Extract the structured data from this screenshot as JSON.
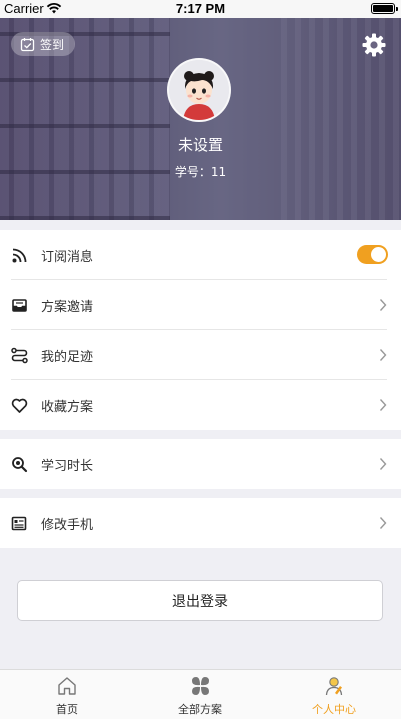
{
  "status_bar": {
    "carrier": "Carrier",
    "time": "7:17 PM",
    "wifi_icon": "wifi-icon",
    "battery_icon": "battery-icon"
  },
  "profile": {
    "checkin_label": "签到",
    "checkin_icon": "calendar-check-icon",
    "settings_icon": "gear-icon",
    "avatar_icon": "cartoon-girl-avatar",
    "nickname": "未设置",
    "student_id_label": "学号：",
    "student_id": "11"
  },
  "menu": {
    "group1": [
      {
        "label": "订阅消息",
        "icon": "rss-icon",
        "control": "toggle",
        "toggle_on": true
      },
      {
        "label": "方案邀请",
        "icon": "inbox-tray-icon",
        "control": "chevron"
      },
      {
        "label": "我的足迹",
        "icon": "route-icon",
        "control": "chevron"
      },
      {
        "label": "收藏方案",
        "icon": "heart-icon",
        "control": "chevron"
      }
    ],
    "group2": [
      {
        "label": "学习时长",
        "icon": "magnifier-icon",
        "control": "chevron"
      }
    ],
    "group3": [
      {
        "label": "修改手机",
        "icon": "document-list-icon",
        "control": "chevron"
      }
    ]
  },
  "logout_label": "退出登录",
  "tabbar": {
    "tabs": [
      {
        "label": "首页",
        "icon": "home-icon",
        "active": false
      },
      {
        "label": "全部方案",
        "icon": "clover-icon",
        "active": false
      },
      {
        "label": "个人中心",
        "icon": "person-icon",
        "active": true
      }
    ]
  },
  "colors": {
    "accent": "#f0a020",
    "header_tint": "#574f6c",
    "background": "#efeff4"
  }
}
